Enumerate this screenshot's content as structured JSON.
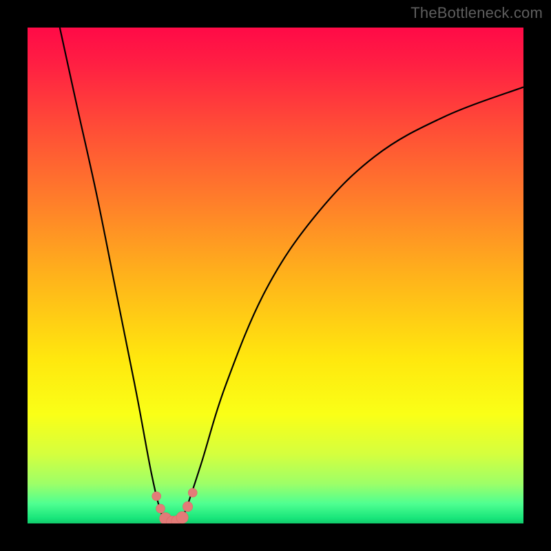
{
  "watermark": "TheBottleneck.com",
  "colors": {
    "frame": "#000000",
    "curve": "#000000",
    "marker_fill": "#e37b78",
    "marker_stroke": "#d86a67"
  },
  "chart_data": {
    "type": "line",
    "title": "",
    "xlabel": "",
    "ylabel": "",
    "xlim": [
      0,
      100
    ],
    "ylim": [
      0,
      100
    ],
    "grid": false,
    "legend": false,
    "note": "Axes are unlabeled in the source image; x represents relative component scaling and y represents bottleneck percentage. Values are estimated by reading curve position against the full plot extent.",
    "series": [
      {
        "name": "left-branch",
        "x": [
          6.5,
          10,
          14,
          18,
          22,
          25,
          27,
          28.5
        ],
        "y": [
          100,
          84,
          66,
          46,
          26,
          10,
          2,
          0
        ]
      },
      {
        "name": "right-branch",
        "x": [
          30.5,
          32,
          35,
          40,
          48,
          58,
          70,
          84,
          100
        ],
        "y": [
          0,
          3,
          12,
          28,
          47,
          62,
          74,
          82,
          88
        ]
      }
    ],
    "markers": {
      "name": "bottom-cluster",
      "points": [
        {
          "x": 26.0,
          "y": 5.5,
          "r": 0.9
        },
        {
          "x": 26.8,
          "y": 3.0,
          "r": 0.9
        },
        {
          "x": 27.8,
          "y": 1.0,
          "r": 1.2
        },
        {
          "x": 29.2,
          "y": 0.3,
          "r": 1.2
        },
        {
          "x": 30.2,
          "y": 0.4,
          "r": 1.2
        },
        {
          "x": 31.2,
          "y": 1.2,
          "r": 1.2
        },
        {
          "x": 32.3,
          "y": 3.4,
          "r": 1.0
        },
        {
          "x": 33.3,
          "y": 6.2,
          "r": 0.9
        }
      ]
    }
  }
}
